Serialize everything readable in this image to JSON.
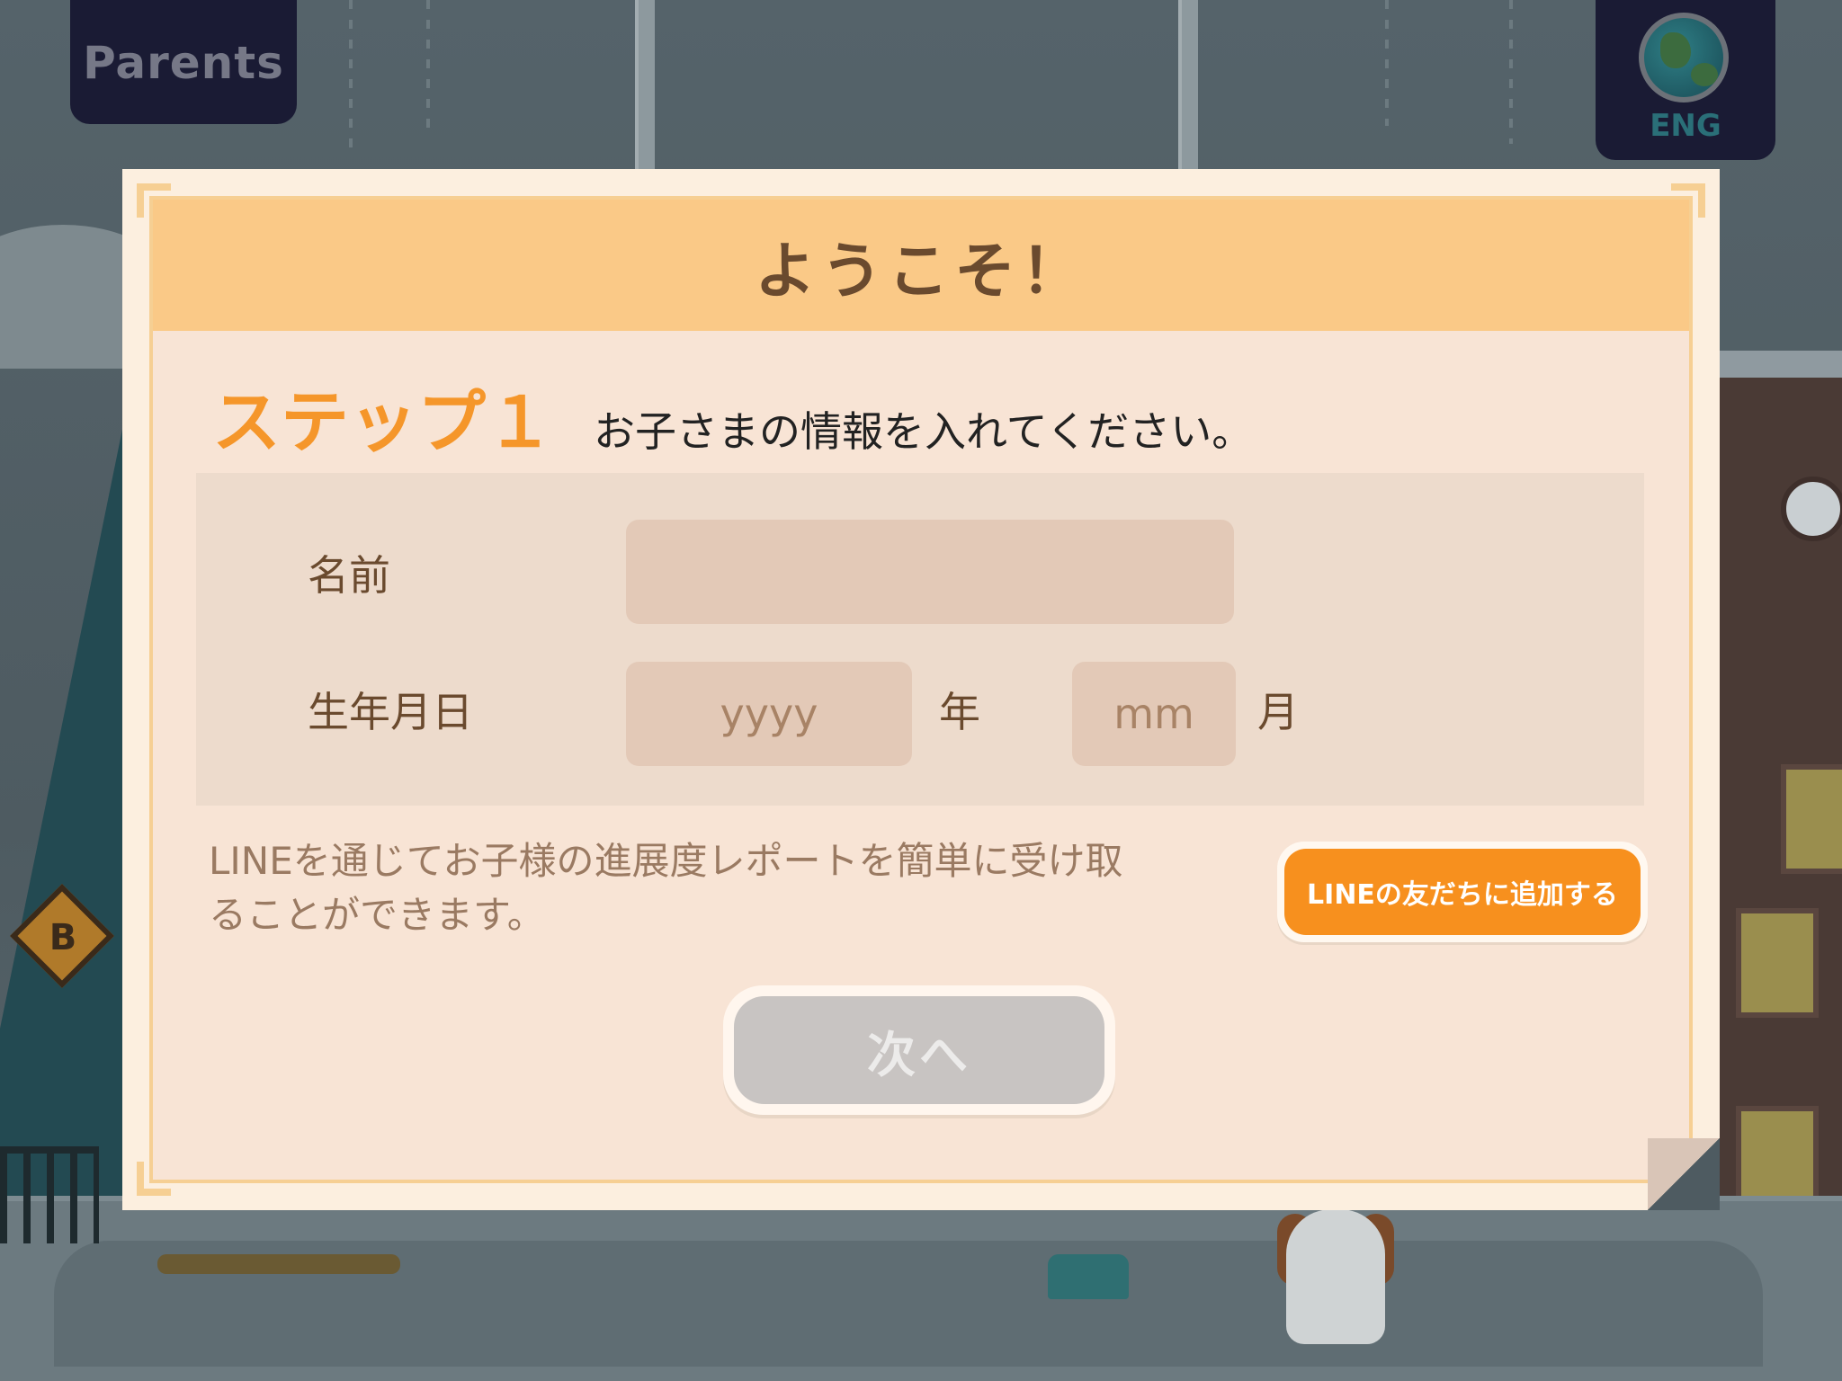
{
  "top_bar": {
    "parents_label": "Parents",
    "language_label": "ENG"
  },
  "background": {
    "sign_letter": "B"
  },
  "modal": {
    "title": "ようこそ！",
    "step_label": "ステップ１",
    "step_instruction": "お子さまの情報を入れてください。",
    "form": {
      "name_label": "名前",
      "name_value": "",
      "birthdate_label": "生年月日",
      "year_placeholder": "yyyy",
      "year_unit": "年",
      "month_placeholder": "mm",
      "month_unit": "月"
    },
    "line_info_text": "LINEを通じてお子様の進展度レポートを簡単に受け取ることができます。",
    "line_button_label": "LINEの友だちに追加する",
    "next_button_label": "次へ"
  },
  "colors": {
    "accent_orange": "#f5962a",
    "header_bg": "#fac987",
    "disabled_button": "#c8c4c2"
  }
}
